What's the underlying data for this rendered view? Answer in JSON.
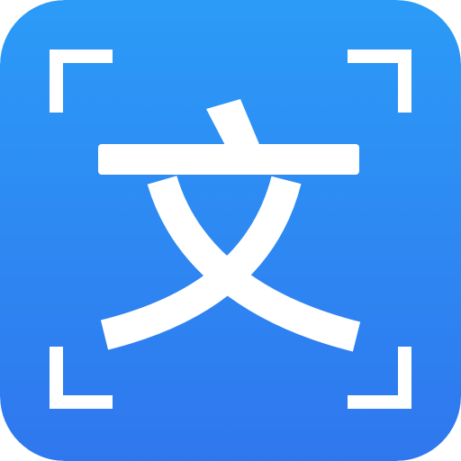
{
  "icon": {
    "name": "text-scan-app-icon",
    "glyph": "文",
    "colors": {
      "gradient_top": "#2c9bf7",
      "gradient_bottom": "#2f77ee",
      "foreground": "#ffffff"
    }
  }
}
